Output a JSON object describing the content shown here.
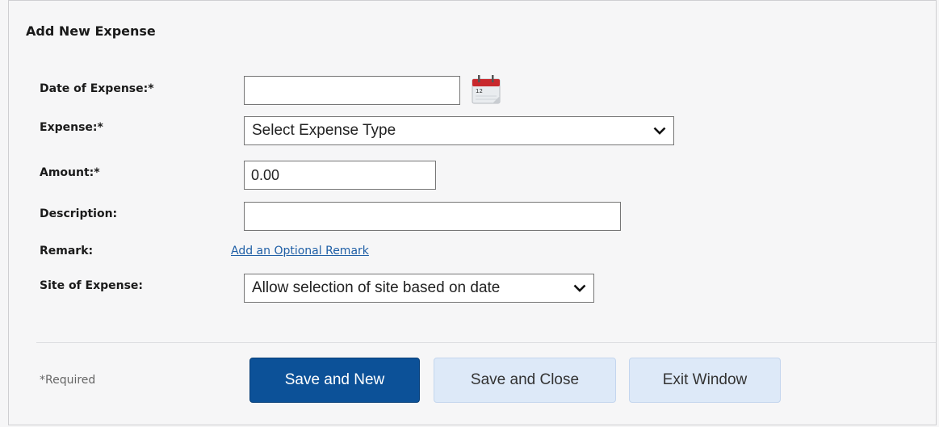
{
  "dialog": {
    "title": "Add New Expense"
  },
  "form": {
    "date": {
      "label": "Date of Expense:*",
      "value": ""
    },
    "expense": {
      "label": "Expense:*",
      "selected": "Select Expense Type"
    },
    "amount": {
      "label": "Amount:*",
      "value": "0.00"
    },
    "description": {
      "label": "Description:",
      "value": ""
    },
    "remark": {
      "label": "Remark:",
      "link": "Add an Optional Remark"
    },
    "site": {
      "label": "Site of Expense:",
      "selected": "Allow selection of site based on date"
    }
  },
  "footer": {
    "required_note": "*Required",
    "save_new": "Save and New",
    "save_close": "Save and Close",
    "exit": "Exit Window"
  },
  "colors": {
    "primary_button": "#0c5198",
    "secondary_button": "#dde9f8",
    "link": "#1f5fa6",
    "calendar_red": "#c8282c"
  }
}
